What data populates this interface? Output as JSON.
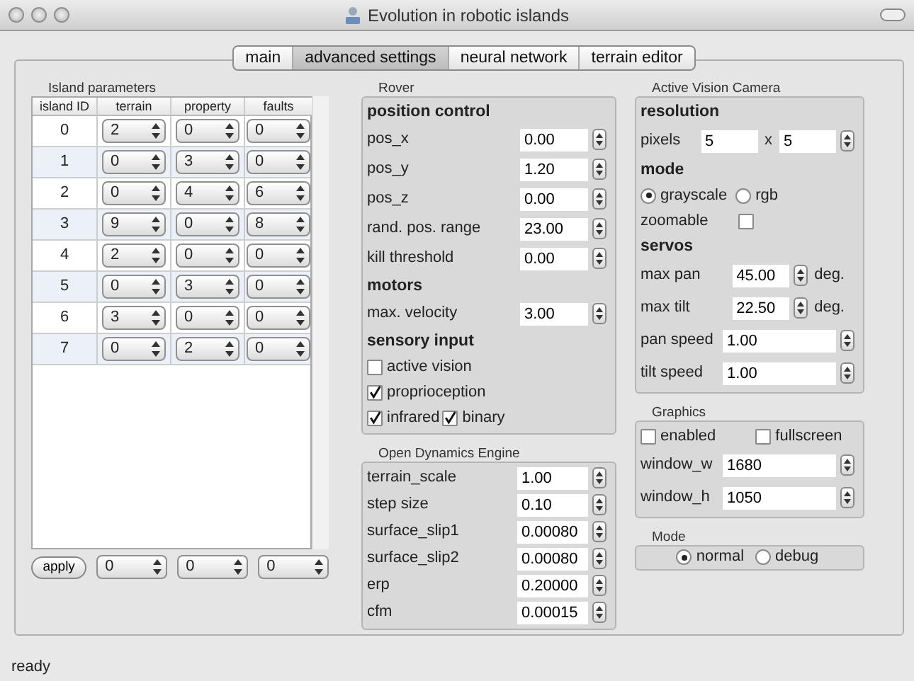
{
  "window": {
    "title": "Evolution in robotic islands"
  },
  "tabs": [
    {
      "label": "main",
      "selected": false
    },
    {
      "label": "advanced settings",
      "selected": true
    },
    {
      "label": "neural network",
      "selected": false
    },
    {
      "label": "terrain editor",
      "selected": false
    }
  ],
  "island_parameters": {
    "title": "Island parameters",
    "columns": [
      "island ID",
      "terrain",
      "property",
      "faults"
    ],
    "rows": [
      [
        "0",
        "2",
        "0",
        "0"
      ],
      [
        "1",
        "0",
        "3",
        "0"
      ],
      [
        "2",
        "0",
        "4",
        "6"
      ],
      [
        "3",
        "9",
        "0",
        "8"
      ],
      [
        "4",
        "2",
        "0",
        "0"
      ],
      [
        "5",
        "0",
        "3",
        "0"
      ],
      [
        "6",
        "3",
        "0",
        "0"
      ],
      [
        "7",
        "0",
        "2",
        "0"
      ]
    ],
    "apply_button": "apply",
    "bottom_values": [
      "0",
      "0",
      "0"
    ]
  },
  "rover": {
    "title": "Rover",
    "items": [
      {
        "kind": "heading",
        "label": "position control"
      },
      {
        "kind": "number",
        "label": "pos_x",
        "value": "0.00"
      },
      {
        "kind": "number",
        "label": "pos_y",
        "value": "1.20"
      },
      {
        "kind": "number",
        "label": "pos_z",
        "value": "0.00"
      },
      {
        "kind": "number",
        "label": "rand. pos. range",
        "value": "23.00"
      },
      {
        "kind": "number",
        "label": "kill threshold",
        "value": "0.00"
      },
      {
        "kind": "heading",
        "label": "motors"
      },
      {
        "kind": "number",
        "label": "max. velocity",
        "value": "3.00"
      },
      {
        "kind": "heading",
        "label": "sensory input"
      },
      {
        "kind": "checks",
        "items": [
          {
            "label": "active vision",
            "checked": false
          }
        ]
      },
      {
        "kind": "checks",
        "items": [
          {
            "label": "proprioception",
            "checked": true
          }
        ]
      },
      {
        "kind": "checks",
        "items": [
          {
            "label": "infrared",
            "checked": true
          },
          {
            "label": "binary",
            "checked": true
          }
        ]
      }
    ]
  },
  "ode": {
    "title": "Open Dynamics Engine",
    "items": [
      {
        "kind": "number",
        "label": "terrain_scale",
        "value": "1.00"
      },
      {
        "kind": "number",
        "label": "step size",
        "value": "0.10"
      },
      {
        "kind": "number",
        "label": "surface_slip1",
        "value": "0.00080"
      },
      {
        "kind": "number",
        "label": "surface_slip2",
        "value": "0.00080"
      },
      {
        "kind": "number",
        "label": "erp",
        "value": "0.20000"
      },
      {
        "kind": "number",
        "label": "cfm",
        "value": "0.00015"
      }
    ]
  },
  "camera": {
    "title": "Active Vision Camera",
    "items": [
      {
        "kind": "heading",
        "label": "resolution"
      },
      {
        "kind": "pixels",
        "label": "pixels",
        "value": "5",
        "separator": "x",
        "value2": "5"
      },
      {
        "kind": "heading",
        "label": "mode"
      },
      {
        "kind": "radios",
        "options": [
          {
            "label": "grayscale",
            "selected": true
          },
          {
            "label": "rgb",
            "selected": false
          }
        ]
      },
      {
        "kind": "check-after",
        "label": "zoomable",
        "checked": false
      },
      {
        "kind": "heading",
        "label": "servos"
      },
      {
        "kind": "unit",
        "label": "max pan",
        "value": "45.00",
        "unit": "deg."
      },
      {
        "kind": "unit",
        "label": "max tilt",
        "value": "22.50",
        "unit": "deg."
      },
      {
        "kind": "wide",
        "label": "pan speed",
        "value": "1.00"
      },
      {
        "kind": "wide",
        "label": "tilt speed",
        "value": "1.00"
      }
    ]
  },
  "graphics": {
    "title": "Graphics",
    "items": [
      {
        "kind": "checks",
        "items": [
          {
            "label": "enabled",
            "checked": false
          },
          {
            "label": "fullscreen",
            "checked": false
          }
        ]
      },
      {
        "kind": "wide",
        "label": "window_w",
        "value": "1680"
      },
      {
        "kind": "wide",
        "label": "window_h",
        "value": "1050"
      }
    ]
  },
  "mode": {
    "title": "Mode",
    "options": [
      {
        "label": "normal",
        "selected": true
      },
      {
        "label": "debug",
        "selected": false
      }
    ]
  },
  "status_bar": "ready"
}
